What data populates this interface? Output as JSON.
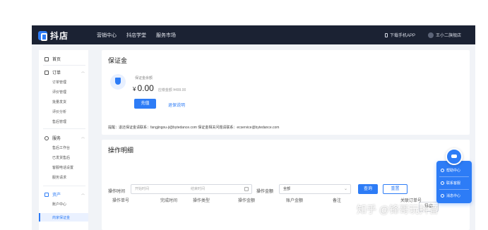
{
  "topbar": {
    "logo": "抖店",
    "nav": [
      "营销中心",
      "抖店学堂",
      "服务市场"
    ],
    "download_app": "下载手机APP",
    "shop_name": "王小二旗舰店"
  },
  "sidebar": {
    "home": "首页",
    "order_group": "订单",
    "order_items": [
      "订单管理",
      "评价管理",
      "批量发货",
      "评价分析",
      "售后管理"
    ],
    "service_group": "服务",
    "service_items": [
      "售后工作台",
      "已发货售后",
      "客服电话设置",
      "服务请求"
    ],
    "asset_group": "资产",
    "asset_items": [
      "账户中心",
      "商家保证金"
    ]
  },
  "deposit": {
    "title": "保证金",
    "balance_label": "保证金余额",
    "currency": "¥",
    "amount": "0.00",
    "amount_note": "应缴金额 ¥499.00",
    "recharge_button": "充值",
    "rules_link": "退保说明",
    "footnote": "提醒：退还保证金请联系：fangjingou-ji@bytedance.com  保证金相关问题请联系：ecservice@bytedance.com"
  },
  "ops": {
    "title": "操作明细",
    "time_label": "操作时间",
    "start_placeholder": "开始时间",
    "end_placeholder": "结束时间",
    "amount_label": "操作金额",
    "amount_value": "全部",
    "query_button": "查询",
    "reset_button": "重置",
    "export_button": "导出",
    "columns": [
      "操作单号",
      "完成时间",
      "操作类型",
      "操作金额",
      "账户金额",
      "备注",
      "关联订单号"
    ]
  },
  "float_panel": {
    "items": [
      "帮助中心",
      "联系客服",
      "消息中心"
    ]
  },
  "watermark": "知乎 @锋哥玩抖音",
  "colors": {
    "brand_blue": "#2d7cf6",
    "topbar_dark": "#1b2233"
  }
}
